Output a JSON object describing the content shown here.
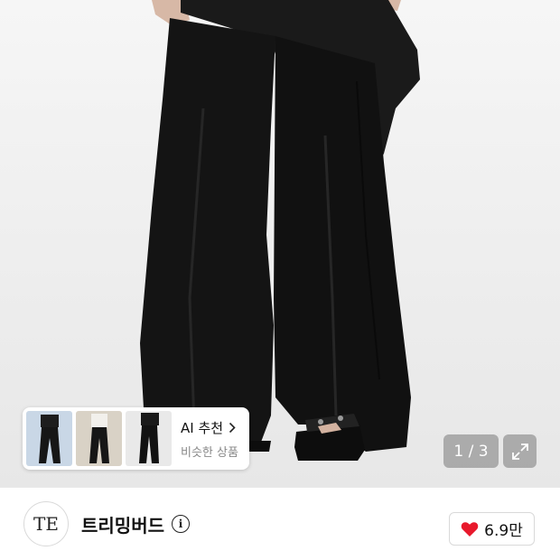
{
  "gallery": {
    "product_image": "black wide flared trousers with draped fabric and black platform sandals",
    "page_counter": "1 / 3"
  },
  "ai_recommend": {
    "title": "AI 추천",
    "subtitle": "비슷한 상품"
  },
  "brand": {
    "logo_text": "TE",
    "name": "트리밍버드"
  },
  "like": {
    "count": "6.9만",
    "color": "#e8192c"
  },
  "colors": {
    "page_counter_bg": "#8a8a8a",
    "garment": "#141414",
    "background": "#efefef"
  }
}
